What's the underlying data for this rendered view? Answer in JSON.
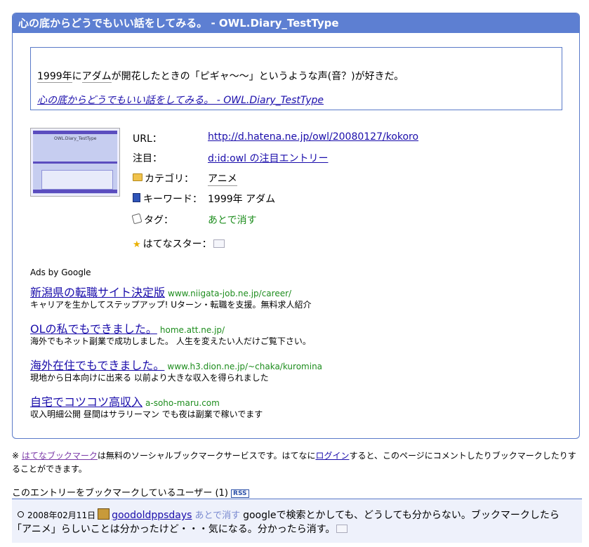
{
  "card": {
    "title": "心の底からどうでもいい話をしてみる。 - OWL.Diary_TestType"
  },
  "quote": {
    "kw_year": "1999年",
    "text_ni": "に",
    "kw_adam": "アダム",
    "text_rest": "が開花したときの「ピギャ〜〜」というような声(音？)が好きだ。",
    "link": "心の底からどうでもいい話をしてみる。 - OWL.Diary_TestType"
  },
  "thumbnail": {
    "caption": "OWL.Diary_TestType"
  },
  "info": {
    "url_label": "URL：",
    "url_value": "http://d.hatena.ne.jp/owl/20080127/kokoro",
    "attention_label": "注目：",
    "attention_value": "d:id:owl の注目エントリー",
    "category_label": "カテゴリ：",
    "category_value": "アニメ",
    "keyword_label": "キーワード：",
    "keyword_value": "1999年 アダム",
    "tag_label": "タグ：",
    "tag_value": "あとで消す",
    "star_label": "はてなスター："
  },
  "ads": {
    "header": "Ads by Google",
    "items": [
      {
        "title": "新潟県の転職サイト決定版",
        "url": "www.niigata-job.ne.jp/career/",
        "desc": "キャリアを生かしてステップアップ! Uターン・転職を支援。無料求人紹介"
      },
      {
        "title": "OLの私でもできました。",
        "url": "home.att.ne.jp/",
        "desc": "海外でもネット副業で成功しました。 人生を変えたい人だけご覧下さい。"
      },
      {
        "title": "海外在住でもできました。",
        "url": "www.h3.dion.ne.jp/~chaka/kuromina",
        "desc": "現地から日本向けに出来る 以前より大きな収入を得られました"
      },
      {
        "title": "自宅でコツコツ高収入",
        "url": "a-soho-maru.com",
        "desc": "収入明細公開 昼間はサラリーマン でも夜は副業で稼いでます"
      }
    ]
  },
  "note": {
    "prefix": "※ ",
    "link1": "はてなブックマーク",
    "mid": "は無料のソーシャルブックマークサービスです。はてなに",
    "link2": "ログイン",
    "suffix": "すると、このページにコメントしたりブックマークしたりすることができます。"
  },
  "users": {
    "header": "このエントリーをブックマークしているユーザー (1)",
    "rss": "RSS"
  },
  "bookmark": {
    "date": "2008年02月11日",
    "user": "goodoldppsdays",
    "tag": "あとで消す",
    "comment1": "googleで検索とかしても、どうしても分からない。ブックマークしたら",
    "comment2": "「アニメ」らしいことは分かったけど・・・気になる。分かったら消す。"
  }
}
